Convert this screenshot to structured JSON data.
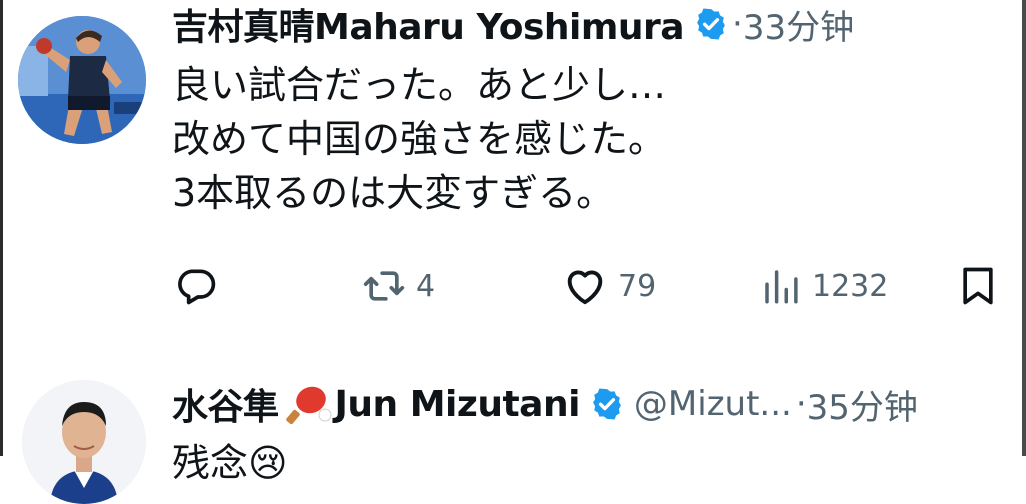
{
  "tweets": [
    {
      "author": {
        "display_name": "吉村真晴Maharu Yoshimura",
        "verified": true,
        "handle": "",
        "avatar_icon": "player-avatar-icon"
      },
      "separator": "·",
      "time": "33分钟",
      "text_lines": [
        "良い試合だった。あと少し…",
        "改めて中国の強さを感じた。",
        "3本取るのは大変すぎる。"
      ],
      "actions": {
        "reply": {
          "icon": "reply-icon",
          "count": ""
        },
        "retweet": {
          "icon": "retweet-icon",
          "count": "4"
        },
        "like": {
          "icon": "heart-icon",
          "count": "79"
        },
        "views": {
          "icon": "views-icon",
          "count": "1232"
        },
        "bookmark": {
          "icon": "bookmark-icon",
          "count": ""
        }
      }
    },
    {
      "author": {
        "display_name_prefix": "水谷隼",
        "display_name_emoji": "ping-pong-paddle-icon",
        "display_name_suffix": "Jun Mizutani",
        "verified": true,
        "handle": "@Mizut..."
      },
      "separator": "·",
      "time": "35分钟",
      "text_lines": [
        "残念😢"
      ]
    }
  ],
  "colors": {
    "text_primary": "#0f1419",
    "text_secondary": "#536471",
    "verified_blue": "#1d9bf0"
  }
}
